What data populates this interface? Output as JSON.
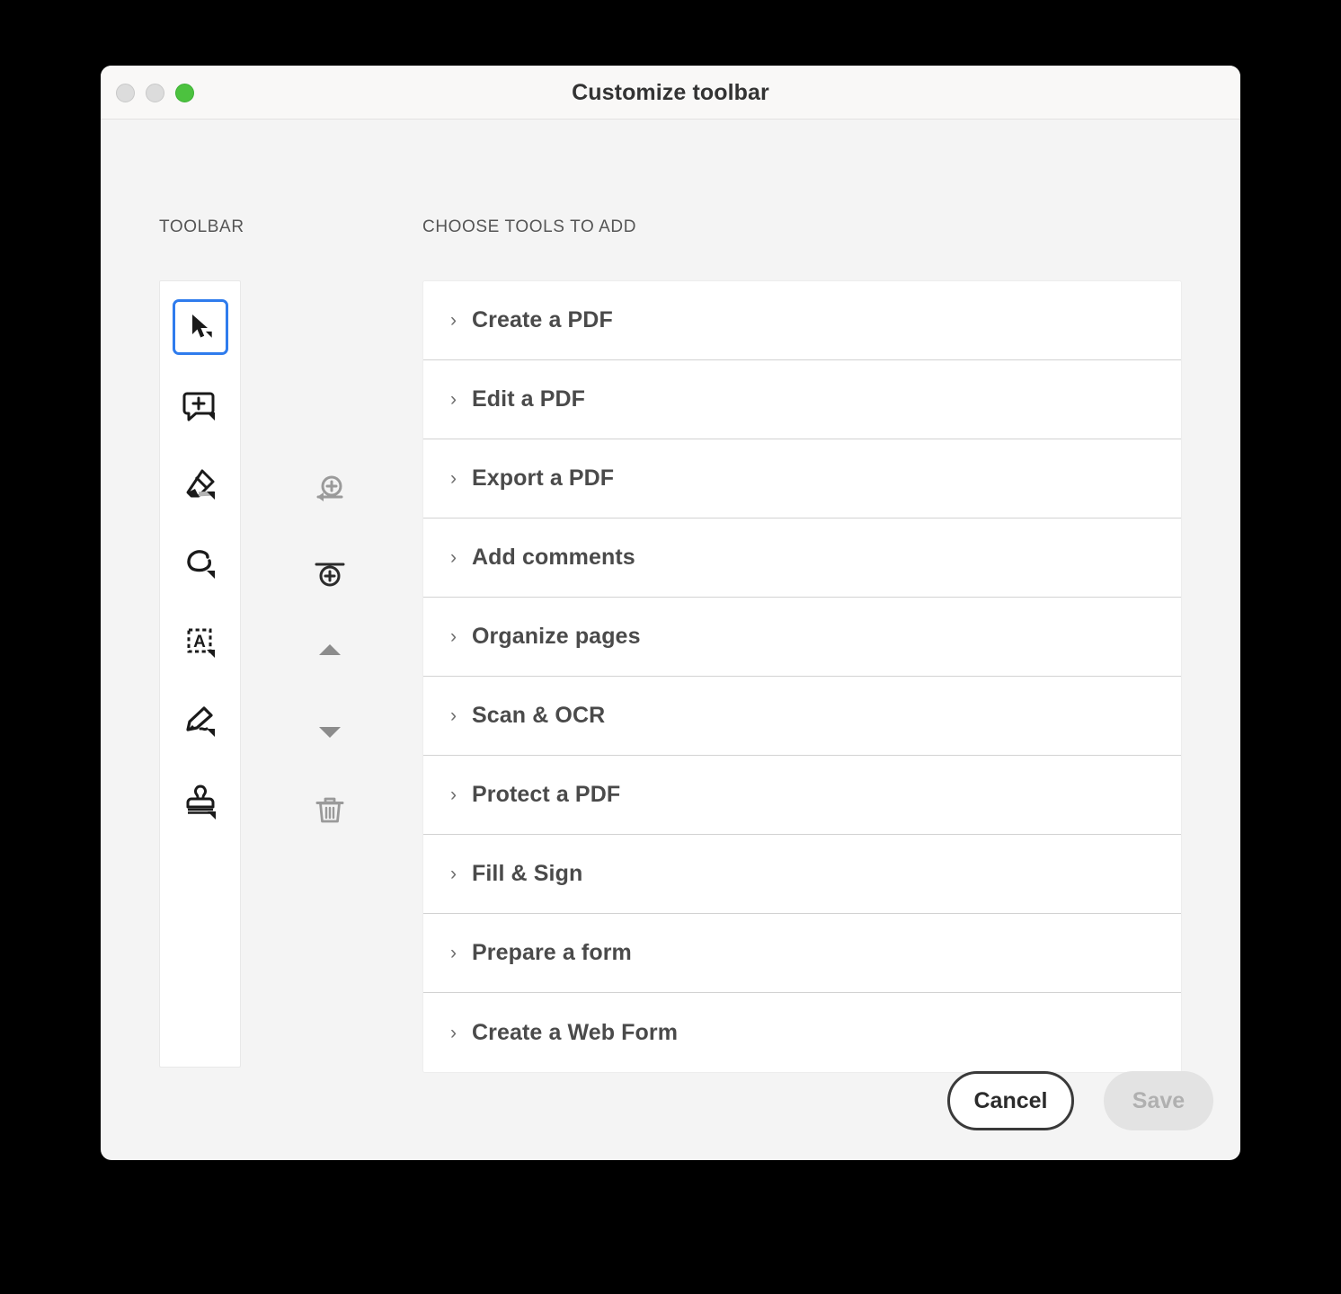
{
  "window": {
    "title": "Customize toolbar",
    "traffic_lights": [
      {
        "name": "close-button",
        "color": "#dcdcdc",
        "state": "disabled"
      },
      {
        "name": "minimize-button",
        "color": "#dcdcdc",
        "state": "disabled"
      },
      {
        "name": "maximize-button",
        "color": "#4cc23f",
        "state": "enabled"
      }
    ]
  },
  "sections": {
    "toolbar_label": "TOOLBAR",
    "choose_label": "CHOOSE TOOLS TO ADD"
  },
  "toolbar_strip": {
    "items": [
      {
        "icon": "select-cursor-icon",
        "label": "Select tool",
        "selected": true
      },
      {
        "icon": "add-comment-icon",
        "label": "Add comment tool",
        "selected": false
      },
      {
        "icon": "highlighter-icon",
        "label": "Highlight tool",
        "selected": false
      },
      {
        "icon": "draw-freehand-icon",
        "label": "Draw freehand tool",
        "selected": false
      },
      {
        "icon": "text-select-icon",
        "label": "Add text tool",
        "selected": false
      },
      {
        "icon": "signature-pen-icon",
        "label": "Sign tool",
        "selected": false
      },
      {
        "icon": "stamp-icon",
        "label": "Stamp tool",
        "selected": false
      }
    ]
  },
  "actions": {
    "items": [
      {
        "icon": "add-tool-icon",
        "label": "Add tool to toolbar",
        "enabled": false
      },
      {
        "icon": "add-separator-icon",
        "label": "Add separator",
        "enabled": true
      },
      {
        "icon": "move-up-icon",
        "label": "Move up",
        "enabled": false
      },
      {
        "icon": "move-down-icon",
        "label": "Move down",
        "enabled": false
      },
      {
        "icon": "trash-icon",
        "label": "Remove",
        "enabled": false
      }
    ]
  },
  "tools_list": {
    "chevron": "›",
    "rows": [
      {
        "label": "Create a PDF"
      },
      {
        "label": "Edit a PDF"
      },
      {
        "label": "Export a PDF"
      },
      {
        "label": "Add comments"
      },
      {
        "label": "Organize pages"
      },
      {
        "label": "Scan & OCR"
      },
      {
        "label": "Protect a PDF"
      },
      {
        "label": "Fill & Sign"
      },
      {
        "label": "Prepare a form"
      },
      {
        "label": "Create a Web Form"
      }
    ]
  },
  "footer": {
    "cancel_label": "Cancel",
    "save_label": "Save",
    "save_enabled": false
  },
  "colors": {
    "accent_blue": "#2f7ced",
    "window_bg": "#f4f4f4",
    "titlebar_bg": "#f9f8f7",
    "panel_bg": "#ffffff",
    "text_dark": "#4a4a4a",
    "text_muted": "#555555",
    "divider": "#d2d2d2",
    "disabled_grey": "#9a9a9a",
    "enabled_dark": "#2b2b2b"
  }
}
